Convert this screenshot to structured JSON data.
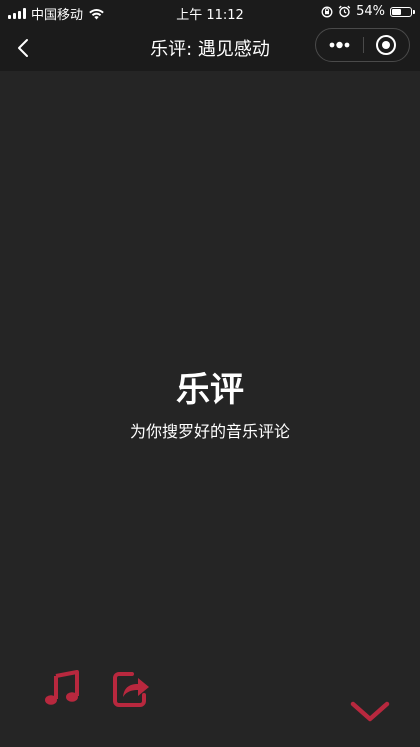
{
  "status_bar": {
    "carrier": "中国移动",
    "time": "上午 11:12",
    "battery": "54%",
    "battery_level": 0.54,
    "icons": [
      "signal-icon",
      "wifi-icon",
      "orientation-lock-icon",
      "alarm-icon",
      "battery-icon"
    ]
  },
  "nav": {
    "title": "乐评: 遇见感动",
    "icons": [
      "back-icon",
      "more-icon",
      "close-target-icon"
    ]
  },
  "hero": {
    "title": "乐评",
    "subtitle": "为你搜罗好的音乐评论"
  },
  "actions": {
    "icons": [
      "music-note-icon",
      "share-icon",
      "chevron-down-icon"
    ],
    "accent_color": "#b8283e"
  },
  "colors": {
    "background": "#252525",
    "bar_background": "#1b1b1b",
    "text": "#ffffff",
    "accent": "#b8283e"
  }
}
